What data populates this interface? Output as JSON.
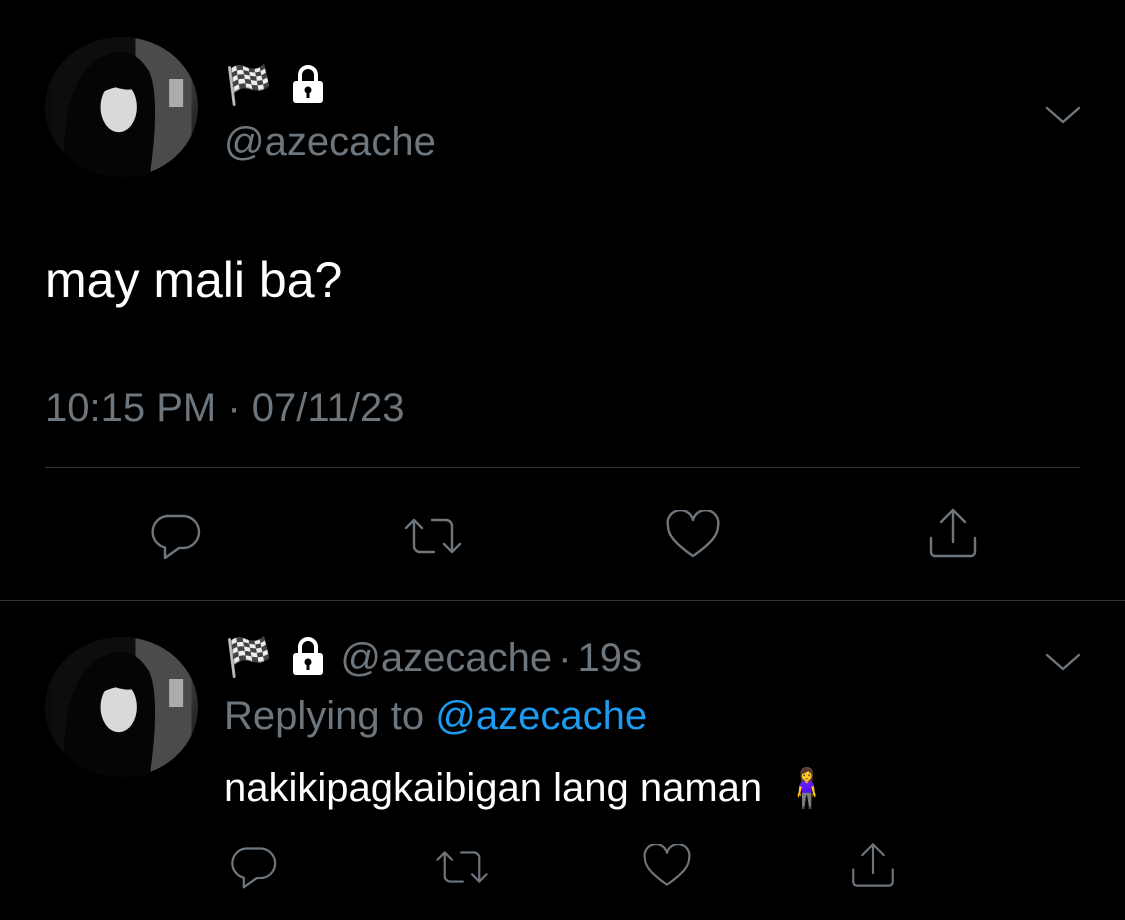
{
  "main_tweet": {
    "display_name_emoji": "🏁",
    "handle": "@azecache",
    "text": "may mali ba?",
    "timestamp": "10:15 PM · 07/11/23"
  },
  "reply_tweet": {
    "display_name_emoji": "🏁",
    "handle": "@azecache",
    "separator": "·",
    "age": "19s",
    "replying_prefix": "Replying to",
    "replying_handle": "@azecache",
    "text": "nakikipagkaibigan lang naman",
    "text_emoji": "🧍‍♀️"
  },
  "icons": {
    "reply": "reply-icon",
    "retweet": "retweet-icon",
    "like": "heart-icon",
    "share": "share-icon",
    "more": "chevron-down-icon",
    "lock": "lock-icon",
    "flag": "checkered-flag-icon"
  },
  "colors": {
    "background": "#000000",
    "text": "#ffffff",
    "muted": "#6e767d",
    "link": "#1d9bf0",
    "divider": "#2f3336"
  }
}
